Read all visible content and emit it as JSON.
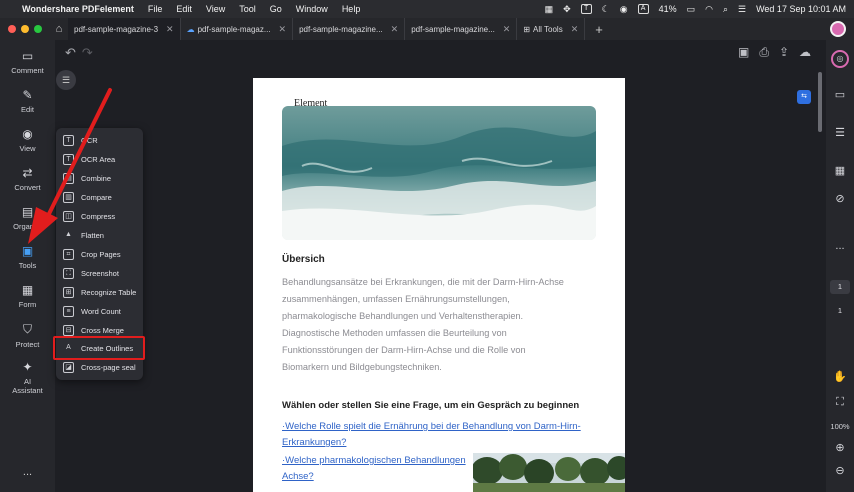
{
  "menubar": {
    "app_name": "Wondershare PDFelement",
    "menus": [
      "File",
      "Edit",
      "View",
      "Tool",
      "Go",
      "Window",
      "Help"
    ],
    "battery": "41%",
    "datetime": "Wed 17 Sep  10:01 AM",
    "status_letters": [
      "T",
      "A"
    ]
  },
  "tabs": [
    {
      "label": "pdf-sample-magazine-3",
      "active": true
    },
    {
      "label": "pdf-sample-magaz...",
      "cloud": true
    },
    {
      "label": "pdf-sample-magazine..."
    },
    {
      "label": "pdf-sample-magazine..."
    },
    {
      "label": "All Tools",
      "icon": "grid-icon"
    }
  ],
  "left_sidebar": {
    "items": [
      {
        "label": "Comment",
        "icon": "comment-icon"
      },
      {
        "label": "Edit",
        "icon": "edit-icon"
      },
      {
        "label": "View",
        "icon": "eye-icon"
      },
      {
        "label": "Convert",
        "icon": "convert-icon"
      },
      {
        "label": "Organi...",
        "icon": "organize-icon"
      },
      {
        "label": "Tools",
        "icon": "tools-icon",
        "active": true
      },
      {
        "label": "Form",
        "icon": "form-icon"
      },
      {
        "label": "Protect",
        "icon": "shield-icon"
      },
      {
        "label": "AI",
        "label2": "Assistant",
        "icon": "ai-icon"
      }
    ],
    "more": "..."
  },
  "tools_popup": {
    "items": [
      "OCR",
      "OCR Area",
      "Combine",
      "Compare",
      "Compress",
      "Flatten",
      "Crop Pages",
      "Screenshot",
      "Recognize Table",
      "Word Count",
      "Cross Merge",
      "Create Outlines",
      "Cross-page seal"
    ],
    "highlighted": "Create Outlines"
  },
  "document": {
    "cursor_text": "Element",
    "heading": "Übersich",
    "paragraph_lines": [
      "Behandlungsansätze bei Erkrankungen, die mit der Darm-Hirn-Achse",
      "zusammenhängen, umfassen Ernährungsumstellungen,",
      "pharmakologische Behandlungen und Verhaltenstherapien.",
      "Diagnostische Methoden umfassen die Beurteilung von",
      "Funktionsstörungen der Darm-Hirn-Achse und die Rolle von",
      "Biomarkern und Bildgebungstechniken."
    ],
    "heading2": "Wählen oder stellen Sie eine Frage, um ein Gespräch zu beginnen",
    "questions": [
      "·Welche Rolle spielt die Ernährung bei der Behandlung von Darm-Hirn-",
      "Erkrankungen?",
      "·Welche pharmakologischen Behandlungen",
      "Achse?"
    ]
  },
  "right_sidebar": {
    "page_current": "1",
    "page_total": "1",
    "zoom": "100%",
    "more": "..."
  },
  "colors": {
    "accent": "#46a0f7",
    "highlight_red": "#e11d1d",
    "link": "#2f63c7"
  }
}
